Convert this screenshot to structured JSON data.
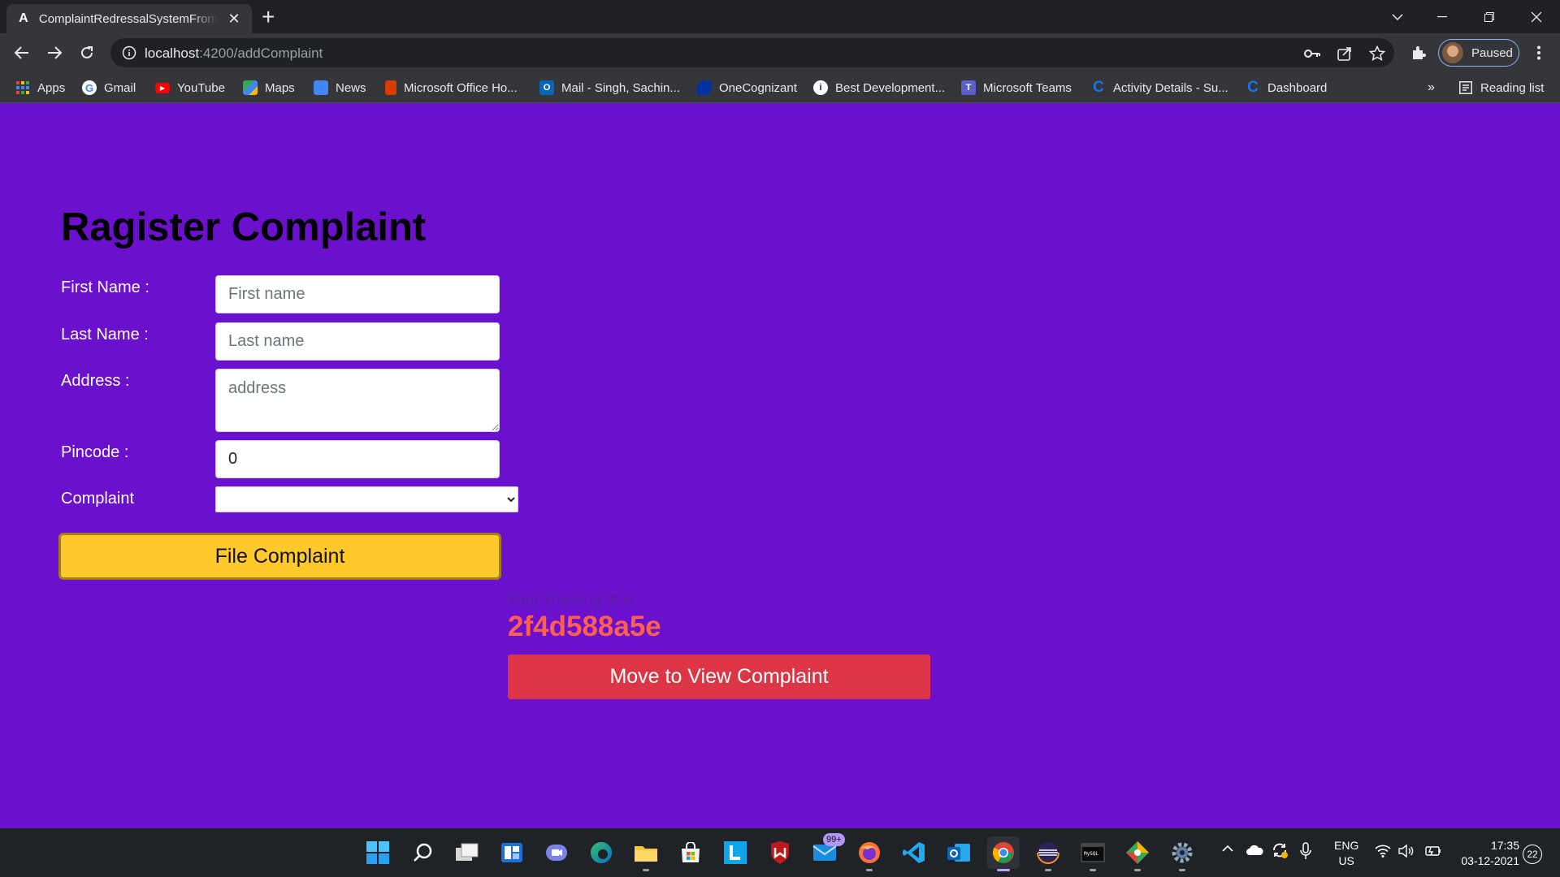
{
  "browser": {
    "tab_title": "ComplaintRedressalSystemFrontend",
    "tab_icon": "angular-logo-icon",
    "url_host": "localhost",
    "url_path": ":4200/addComplaint",
    "profile_status": "Paused"
  },
  "bookmarks": {
    "items": [
      {
        "label": "Apps",
        "icon": "apps-grid-icon"
      },
      {
        "label": "Gmail",
        "icon": "google-icon"
      },
      {
        "label": "YouTube",
        "icon": "youtube-icon"
      },
      {
        "label": "Maps",
        "icon": "maps-icon"
      },
      {
        "label": "News",
        "icon": "news-icon"
      },
      {
        "label": "Microsoft Office Ho...",
        "icon": "office-icon"
      },
      {
        "label": "Mail - Singh, Sachin...",
        "icon": "outlook-icon"
      },
      {
        "label": "OneCognizant",
        "icon": "cognizant-icon"
      },
      {
        "label": "Best Development...",
        "icon": "globe-icon"
      },
      {
        "label": "Microsoft Teams",
        "icon": "teams-icon"
      },
      {
        "label": "Activity Details - Su...",
        "icon": "c-logo-icon"
      },
      {
        "label": "Dashboard",
        "icon": "c-logo-icon"
      }
    ],
    "overflow": "»",
    "reading_list": "Reading list"
  },
  "form": {
    "title": "Ragister Complaint",
    "first_name_label": "First Name :",
    "first_name_placeholder": "First name",
    "last_name_label": "Last Name :",
    "last_name_placeholder": "Last name",
    "address_label": "Address :",
    "address_placeholder": "address",
    "pincode_label": "Pincode :",
    "pincode_value": "0",
    "complaint_label": "Complaint",
    "complaint_selected": "",
    "submit_label": "File Complaint"
  },
  "result": {
    "tracking_label": "Your Tracking id is :",
    "tracking_id": "2f4d588a5e",
    "view_button_label": "Move to View Complaint"
  },
  "taskbar": {
    "mail_badge": "99+",
    "language": "ENG",
    "region": "US",
    "time": "17:35",
    "date": "03-12-2021",
    "notification_count": "22"
  },
  "colors": {
    "page_background": "#6b10cd",
    "file_button": "#ffc82b",
    "view_button": "#dc3545",
    "tracking_id": "#ff5f50"
  }
}
